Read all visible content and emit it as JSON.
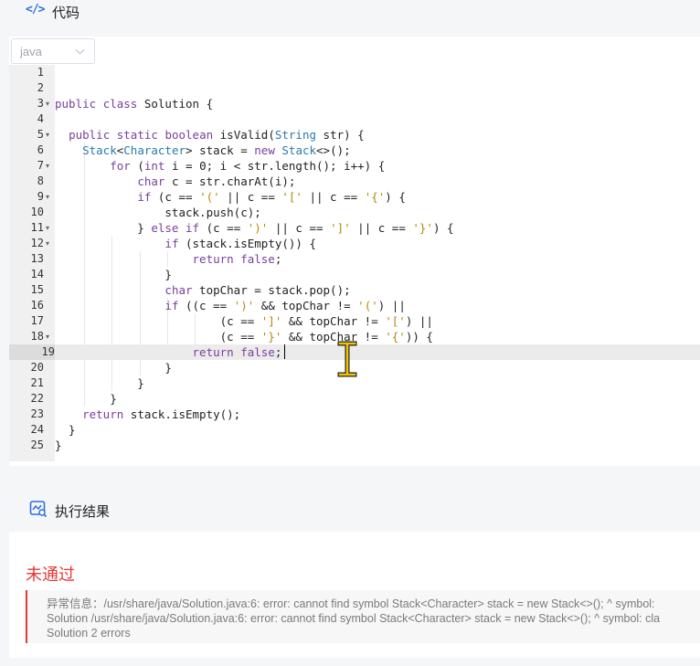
{
  "code_section": {
    "icon": "</>",
    "title": "代码"
  },
  "editor": {
    "language": "java",
    "active_line": 19,
    "lines": [
      "",
      "",
      "public class Solution {",
      "",
      "  public static boolean isValid(String str) {",
      "    Stack<Character> stack = new Stack<>();",
      "        for (int i = 0; i < str.length(); i++) {",
      "            char c = str.charAt(i);",
      "            if (c == '(' || c == '[' || c == '{') {",
      "                stack.push(c);",
      "            } else if (c == ')' || c == ']' || c == '}') {",
      "                if (stack.isEmpty()) {",
      "                    return false;",
      "                }",
      "                char topChar = stack.pop();",
      "                if ((c == ')' && topChar != '(') ||",
      "                        (c == ']' && topChar != '[') ||",
      "                        (c == '}' && topChar != '{')) {",
      "                    return false;",
      "                }",
      "            }",
      "        }",
      "    return stack.isEmpty();",
      "  }",
      "}"
    ],
    "fold_lines": [
      3,
      5,
      7,
      9,
      11,
      12,
      18
    ]
  },
  "result_section": {
    "icon": "result-icon",
    "title": "执行结果",
    "status": "未通过",
    "error_lines": [
      "异常信息：/usr/share/java/Solution.java:6: error: cannot find symbol Stack<Character> stack = new Stack<>(); ^ symbol:",
      "Solution /usr/share/java/Solution.java:6: error: cannot find symbol Stack<Character> stack = new Stack<>(); ^ symbol: cla",
      "Solution 2 errors"
    ]
  },
  "colors": {
    "accent": "#2f6fe0",
    "error": "#e53935"
  }
}
